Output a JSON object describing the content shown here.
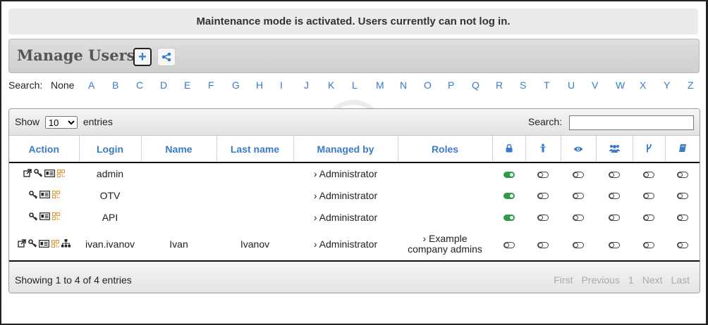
{
  "banner": "Maintenance mode is activated. Users currently can not log in.",
  "header": {
    "title": "Manage Users",
    "add_icon": "plus-icon",
    "share_icon": "share-icon"
  },
  "alpha": {
    "label": "Search:",
    "none": "None",
    "letters": [
      "A",
      "B",
      "C",
      "D",
      "E",
      "F",
      "G",
      "H",
      "I",
      "J",
      "K",
      "L",
      "M",
      "N",
      "O",
      "P",
      "Q",
      "R",
      "S",
      "T",
      "U",
      "V",
      "W",
      "X",
      "Y",
      "Z"
    ]
  },
  "table": {
    "show_label": "Show",
    "entries_label": "entries",
    "page_size": "10",
    "search_label": "Search:",
    "search_value": "",
    "columns": [
      "Action",
      "Login",
      "Name",
      "Last name",
      "Managed by",
      "Roles"
    ],
    "icon_columns": [
      "lock-icon",
      "person-icon",
      "eye-icon",
      "group-icon",
      "branch-icon",
      "book-icon"
    ],
    "rows": [
      {
        "actions": [
          "external-link-icon",
          "key-icon",
          "id-card-icon",
          "qr-icon"
        ],
        "login": "admin",
        "name": "",
        "last_name": "",
        "managed_by": "› Administrator",
        "roles": "",
        "toggles": [
          true,
          false,
          false,
          false,
          false,
          false
        ]
      },
      {
        "actions": [
          "key-icon",
          "id-card-icon",
          "qr-icon"
        ],
        "login": "OTV",
        "name": "",
        "last_name": "",
        "managed_by": "› Administrator",
        "roles": "",
        "toggles": [
          true,
          false,
          false,
          false,
          false,
          false
        ]
      },
      {
        "actions": [
          "key-icon",
          "id-card-icon",
          "qr-icon"
        ],
        "login": "API",
        "name": "",
        "last_name": "",
        "managed_by": "› Administrator",
        "roles": "",
        "toggles": [
          true,
          false,
          false,
          false,
          false,
          false
        ]
      },
      {
        "actions": [
          "external-link-icon",
          "key-icon",
          "id-card-icon",
          "qr-icon",
          "hierarchy-icon"
        ],
        "login": "ivan.ivanov",
        "name": "Ivan",
        "last_name": "Ivanov",
        "managed_by": "› Administrator",
        "roles": "› Example company admins",
        "toggles": [
          false,
          false,
          false,
          false,
          false,
          false
        ]
      }
    ],
    "info": "Showing 1 to 4 of 4 entries",
    "pager": [
      "First",
      "Previous",
      "1",
      "Next",
      "Last"
    ]
  }
}
